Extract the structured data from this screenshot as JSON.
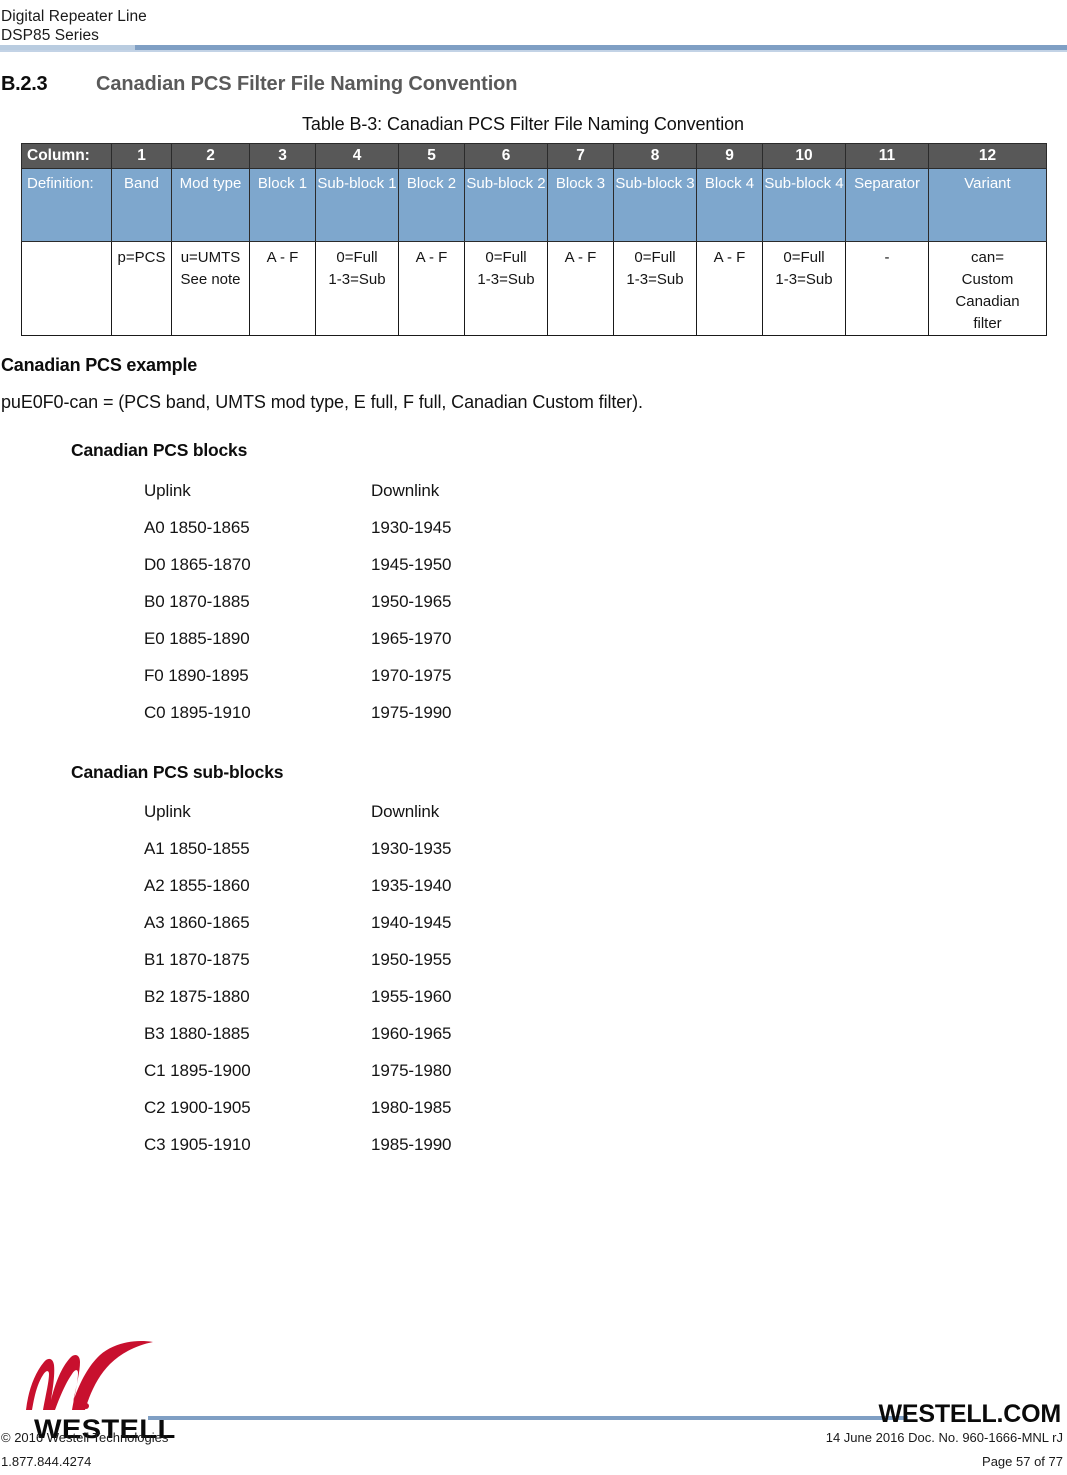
{
  "header": {
    "line1": "Digital Repeater Line",
    "line2": "DSP85 Series",
    "rule_color": "#7f9fc4"
  },
  "section": {
    "number": "B.2.3",
    "title": "Canadian PCS Filter File Naming Convention",
    "title_color": "#5a5a5a"
  },
  "table": {
    "caption": "Table B-3: Canadian PCS Filter File Naming Convention",
    "header_bg": "#585858",
    "definition_bg": "#7ea7cd",
    "row_labels": {
      "column": "Column:",
      "definition": "Definition:",
      "values": ""
    },
    "columns": [
      {
        "number": "1",
        "definition": "Band",
        "value_lines": [
          "p=PCS"
        ]
      },
      {
        "number": "2",
        "definition": "Mod type",
        "value_lines": [
          "u=UMTS",
          "See note"
        ]
      },
      {
        "number": "3",
        "definition": "Block 1",
        "value_lines": [
          "A - F"
        ]
      },
      {
        "number": "4",
        "definition": "Sub-block 1",
        "value_lines": [
          "0=Full",
          "1-3=Sub"
        ]
      },
      {
        "number": "5",
        "definition": "Block 2",
        "value_lines": [
          "A - F"
        ]
      },
      {
        "number": "6",
        "definition": "Sub-block 2",
        "value_lines": [
          "0=Full",
          "1-3=Sub"
        ]
      },
      {
        "number": "7",
        "definition": "Block 3",
        "value_lines": [
          "A - F"
        ]
      },
      {
        "number": "8",
        "definition": "Sub-block 3",
        "value_lines": [
          "0=Full",
          "1-3=Sub"
        ]
      },
      {
        "number": "9",
        "definition": "Block 4",
        "value_lines": [
          "A - F"
        ]
      },
      {
        "number": "10",
        "definition": "Sub-block 4",
        "value_lines": [
          "0=Full",
          "1-3=Sub"
        ]
      },
      {
        "number": "11",
        "definition": "Separator",
        "value_lines": [
          "-"
        ]
      },
      {
        "number": "12",
        "definition": "Variant",
        "value_lines": [
          "can=",
          "Custom",
          "Canadian",
          "filter"
        ]
      }
    ]
  },
  "example": {
    "heading": "Canadian PCS example",
    "text": "puE0F0-can = (PCS band, UMTS mod type, E full, F full, Canadian Custom filter)."
  },
  "blocks": {
    "heading": "Canadian PCS blocks",
    "col_uplink": "Uplink",
    "col_downlink": "Downlink",
    "rows": [
      {
        "uplink": "A0 1850-1865",
        "downlink": "1930-1945"
      },
      {
        "uplink": "D0 1865-1870",
        "downlink": "1945-1950"
      },
      {
        "uplink": "B0 1870-1885",
        "downlink": "1950-1965"
      },
      {
        "uplink": "E0 1885-1890",
        "downlink": "1965-1970"
      },
      {
        "uplink": "F0 1890-1895",
        "downlink": "1970-1975"
      },
      {
        "uplink": "C0 1895-1910",
        "downlink": "1975-1990"
      }
    ]
  },
  "subblocks": {
    "heading": "Canadian PCS sub-blocks",
    "col_uplink": "Uplink",
    "col_downlink": "Downlink",
    "rows": [
      {
        "uplink": "A1 1850-1855",
        "downlink": "1930-1935"
      },
      {
        "uplink": "A2 1855-1860",
        "downlink": "1935-1940"
      },
      {
        "uplink": "A3 1860-1865",
        "downlink": "1940-1945"
      },
      {
        "uplink": "B1 1870-1875",
        "downlink": "1950-1955"
      },
      {
        "uplink": "B2 1875-1880",
        "downlink": "1955-1960"
      },
      {
        "uplink": "B3 1880-1885",
        "downlink": "1960-1965"
      },
      {
        "uplink": "C1 1895-1900",
        "downlink": "1975-1980"
      },
      {
        "uplink": "C2 1900-1905",
        "downlink": "1980-1985"
      },
      {
        "uplink": "C3 1905-1910",
        "downlink": "1985-1990"
      }
    ]
  },
  "footer": {
    "logo_wordmark": "WESTELL",
    "logo_color": "#c8102e",
    "dotcom": "WESTELL.COM",
    "copyright": "© 2016 Westell Technologies",
    "phone": "1.877.844.4274",
    "doc_info": "14 June 2016 Doc. No. 960-1666-MNL rJ",
    "page_info": "Page 57 of 77"
  }
}
